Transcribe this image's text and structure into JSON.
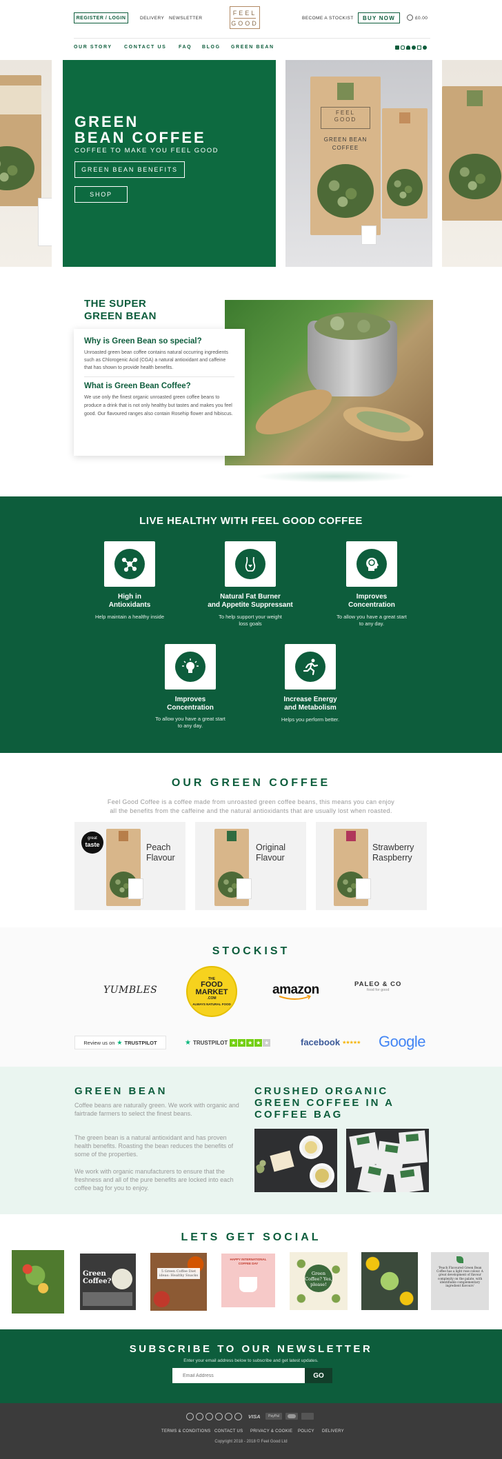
{
  "header": {
    "register": "REGISTER / LOGIN",
    "delivery": "DELIVERY",
    "newsletter": "NEWSLETTER",
    "logo_line1": "FEEL",
    "logo_line2": "GOOD",
    "stockist": "BECOME A STOCKIST",
    "buy_now": "BUY NOW",
    "cart": "£0.00"
  },
  "nav": {
    "items": [
      "OUR STORY",
      "CONTACT US",
      "FAQ",
      "BLOG",
      "GREEN BEAN"
    ]
  },
  "hero": {
    "title_line1": "GREEN",
    "title_line2": "BEAN COFFEE",
    "subtitle": "COFFEE TO MAKE YOU FEEL GOOD",
    "btn_benefits": "GREEN BEAN BENEFITS",
    "btn_shop": "SHOP",
    "bag_brand1": "FEEL",
    "bag_brand2": "GOOD",
    "bag_label1": "GREEN BEAN",
    "bag_label2": "COFFEE"
  },
  "super": {
    "title_line1": "THE SUPER",
    "title_line2": "GREEN BEAN",
    "q1": "Why is Green Bean so special?",
    "a1": "Unroasted green bean coffee contains natural occurring ingredients such as Chlorogenic Acid (CGA) a natural antioxidant and caffeine that has shown to provide health benefits.",
    "q2": "What is Green Bean Coffee?",
    "a2": "We use only the finest organic unroasted green coffee beans to produce a drink that is not only healthy but tastes and makes you feel good. Our flavoured ranges also contain Rosehip flower and hibiscus."
  },
  "live": {
    "heading": "LIVE HEALTHY WITH FEEL GOOD COFFEE",
    "features": [
      {
        "title1": "High in",
        "title2": "Antioxidants",
        "desc1": "Help maintain a healthy inside",
        "desc2": "",
        "icon": "molecule-icon"
      },
      {
        "title1": "Natural Fat Burner",
        "title2": "and Appetite Suppressant",
        "desc1": "To help support your weight",
        "desc2": "loss goals",
        "icon": "body-icon"
      },
      {
        "title1": "Improves",
        "title2": "Concentration",
        "desc1": "To allow you have a great start",
        "desc2": "to any day.",
        "icon": "head-icon"
      },
      {
        "title1": "Improves",
        "title2": "Concentration",
        "desc1": "To allow you have a great start",
        "desc2": "to any day.",
        "icon": "lightbulb-icon"
      },
      {
        "title1": "Increase Energy",
        "title2": "and Metabolism",
        "desc1": "Helps you perform better.",
        "desc2": "",
        "icon": "runner-icon"
      }
    ]
  },
  "coffee": {
    "heading": "OUR GREEN COFFEE",
    "intro1": "Feel Good Coffee is a coffee made from unroasted green coffee beans, this means you can enjoy",
    "intro2": "all the benefits from the caffeine and the natural antioxidants that are usually lost when roasted.",
    "badge_great": "great",
    "badge_taste": "taste",
    "products": [
      {
        "line1": "Peach",
        "line2": "Flavour",
        "accent": "#b77e4a"
      },
      {
        "line1": "Original",
        "line2": "Flavour",
        "accent": "#2f6b3f"
      },
      {
        "line1": "Strawberry",
        "line2": "Raspberry",
        "accent": "#b0365a"
      }
    ]
  },
  "stockist": {
    "heading": "STOCKIST",
    "yumbles": "YUMBLES",
    "foodmarket1": "THE",
    "foodmarket2": "FOOD",
    "foodmarket3": "MARKET",
    "foodmarket4": ".COM",
    "foodmarket5": "ALWAYS NATURAL FOOD",
    "amazon": "amazon",
    "paleo1": "PALEO & CO",
    "paleo2": "food for good",
    "review_on": "Review us on",
    "trustpilot": "TRUSTPILOT",
    "facebook": "facebook",
    "google": "Google"
  },
  "green_bean": {
    "heading": "GREEN BEAN",
    "p1": "Coffee beans are naturally green.  We work with organic and fairtrade farmers to select the finest beans.",
    "p2": "The green bean is a natural antioxidant and has proven health benefits.  Roasting the bean reduces the benefits of some of the properties.",
    "p3": "We work with organic manufacturers to ensure that the freshness and all of the pure benefits are locked into each coffee bag for you to enjoy.",
    "crushed_line1": "CRUSHED ORGANIC",
    "crushed_line2": "GREEN COFFEE IN A",
    "crushed_line3": "COFFEE BAG"
  },
  "social": {
    "heading": "LETS GET SOCIAL",
    "tile2": "Green Coffee?",
    "tile3": "5 Green Coffee Diet ideas: Healthy Snacks",
    "tile4": "HAPPY INTERNATIONAL COFFEE DAY",
    "tile5": "Green Coffee? Yes, please!",
    "tile7": "'Peach Flavoured Green Bean Coffee has a light rose colour. A great development of flavour complexity on the palate, with identifiable complementary ingredient flavours'"
  },
  "newsletter": {
    "heading": "SUBSCRIBE TO OUR NEWSLETTER",
    "sub": "Enter your email address below to subscribe and get latest updates.",
    "placeholder": "Email Address",
    "go": "GO"
  },
  "footer": {
    "visa": "VISA",
    "paypal": "PayPal",
    "links": [
      "TERMS & CONDITIONS",
      "CONTACT US",
      "PRIVACY & COOKIE",
      "POLICY",
      "DELIVERY"
    ],
    "copyright": "Copyright 2018 - 2018 © Feel Good Ltd"
  },
  "colors": {
    "brand_green": "#0d5d3c",
    "light_green_bg": "#eaf5f0",
    "footer_bg": "#3b3b3b"
  }
}
